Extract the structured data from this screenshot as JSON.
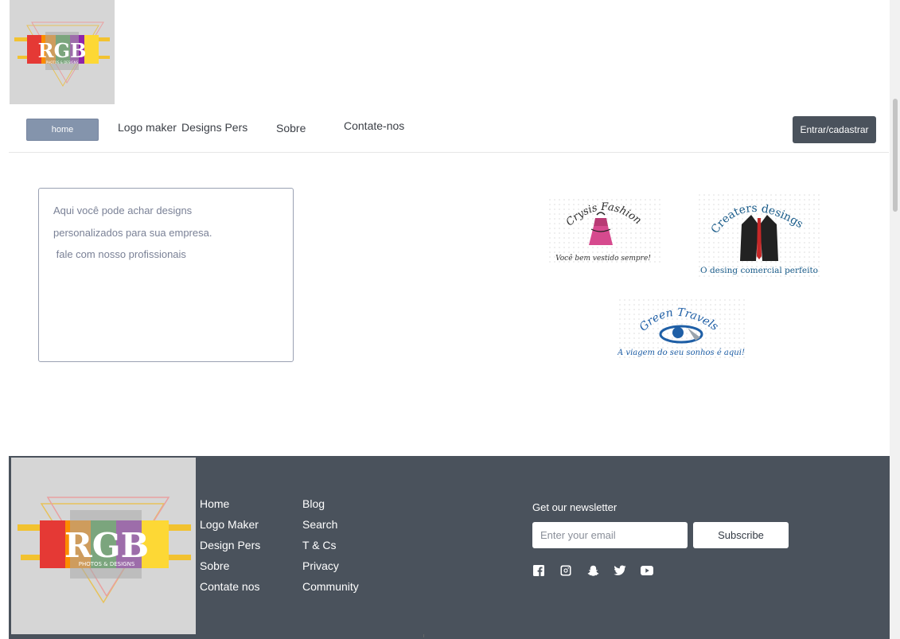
{
  "brand": {
    "logo_main": "RGB",
    "logo_sub": "PHOTOS & DESIGNS"
  },
  "nav": {
    "home": "home",
    "logo_maker": "Logo maker",
    "designs_pers": "Designs Pers",
    "sobre": "Sobre",
    "contate": "Contate-nos",
    "login": "Entrar/cadastrar"
  },
  "intro": {
    "line1": "Aqui você pode achar designs",
    "line2": "personalizados para sua empresa.",
    "line3": " fale com nosso profissionais"
  },
  "showcase": [
    {
      "name": "Crysis Fashion",
      "tagline": "Você bem vestido sempre!",
      "color": "#2b2b2b",
      "accent": "#d64a8e"
    },
    {
      "name": "Creaters desings",
      "tagline": "O desing comercial perfeito",
      "color": "#1a5c8a",
      "accent": "#c62828"
    },
    {
      "name": "Green Travels",
      "tagline": "A viagem do seu sonhos é aqui!",
      "color": "#1f5fa6",
      "accent": "#4aa3df"
    }
  ],
  "footer": {
    "col1": [
      "Home",
      "Logo Maker",
      "Design Pers",
      "Sobre",
      "Contate nos"
    ],
    "col2": [
      "Blog",
      "Search",
      "T & Cs",
      "Privacy",
      "Community"
    ],
    "newsletter_title": "Get our newsletter",
    "email_placeholder": "Enter your email",
    "subscribe": "Subscribe",
    "social_icons": [
      "facebook-icon",
      "instagram-icon",
      "snapchat-icon",
      "twitter-icon",
      "youtube-icon"
    ]
  },
  "colors": {
    "nav_home_bg": "#8494ac",
    "dark": "#4a525c"
  }
}
